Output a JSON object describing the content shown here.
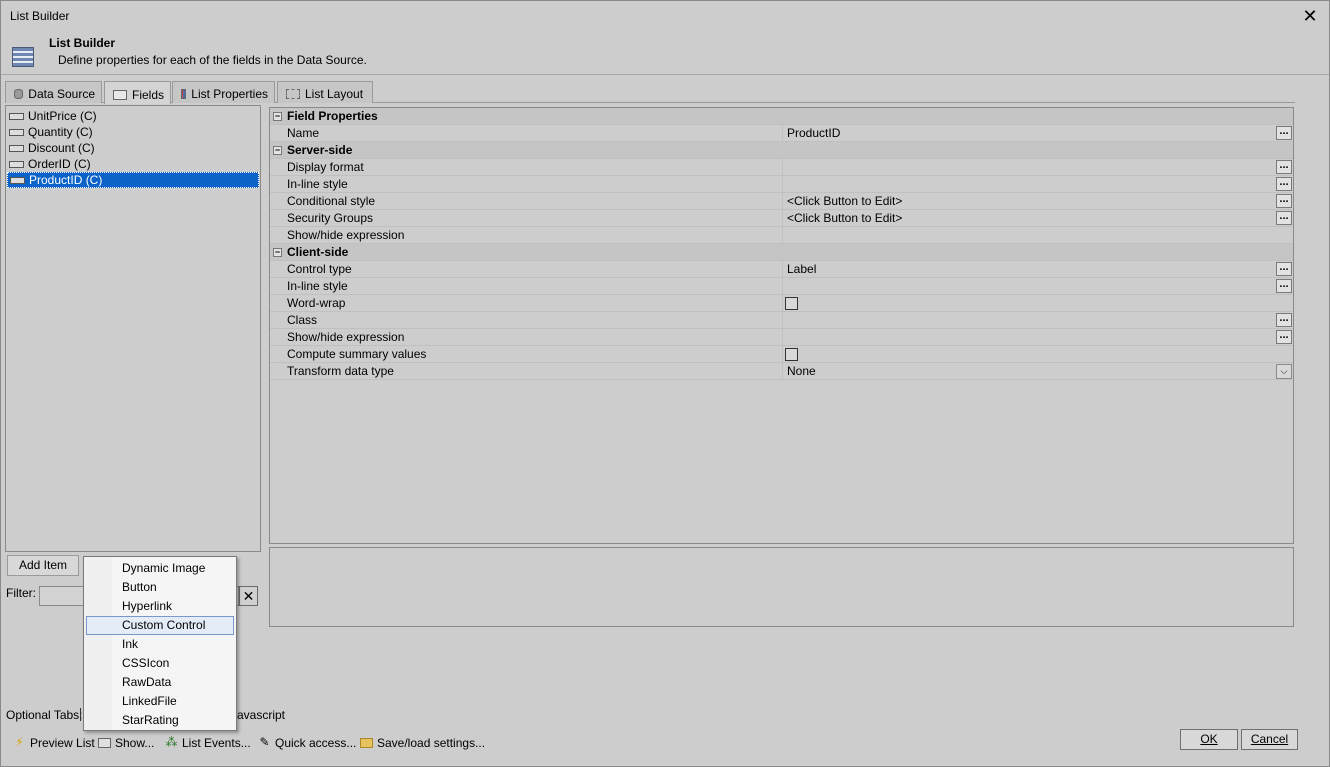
{
  "window": {
    "title": "List Builder",
    "close_glyph": "✕"
  },
  "header": {
    "title": "List Builder",
    "description": "Define properties for each of the fields in the Data Source.",
    "icon": "list-builder-icon"
  },
  "tabs": [
    {
      "label": "Data Source",
      "icon": "database-icon"
    },
    {
      "label": "Fields",
      "icon": "field-icon"
    },
    {
      "label": "List Properties",
      "icon": "list-properties-icon"
    },
    {
      "label": "List Layout",
      "icon": "list-layout-icon"
    }
  ],
  "active_tab": "Fields",
  "fields": [
    {
      "label": "UnitPrice (C)"
    },
    {
      "label": "Quantity (C)"
    },
    {
      "label": "Discount (C)"
    },
    {
      "label": "OrderID (C)"
    },
    {
      "label": "ProductID (C)"
    }
  ],
  "selected_field": "ProductID (C)",
  "add_item_label": "Add Item",
  "filter": {
    "label": "Filter:",
    "value": "",
    "clear_glyph": "✕"
  },
  "properties": {
    "field_properties": {
      "title": "Field Properties",
      "name_label": "Name",
      "name_value": "ProductID"
    },
    "server_side": {
      "title": "Server-side",
      "display_format": "Display format",
      "inline_style": "In-line style",
      "conditional_style": "Conditional style",
      "conditional_style_value": "<Click Button to Edit>",
      "security_groups": "Security Groups",
      "security_groups_value": "<Click Button to Edit>",
      "show_hide_expression": "Show/hide expression"
    },
    "client_side": {
      "title": "Client-side",
      "control_type": "Control type",
      "control_type_value": "Label",
      "inline_style": "In-line style",
      "word_wrap": "Word-wrap",
      "class": "Class",
      "show_hide_expression": "Show/hide expression",
      "compute_summary": "Compute summary values",
      "transform_data_type": "Transform data type",
      "transform_data_type_value": "None"
    },
    "ellipsis": "...",
    "collapse_glyph": "−",
    "dropdown_glyph": "⌵"
  },
  "context_menu": {
    "items": [
      "Dynamic Image",
      "Button",
      "Hyperlink",
      "Custom Control",
      "Ink",
      "CSSIcon",
      "RawData",
      "LinkedFile",
      "StarRating"
    ],
    "highlighted": "Custom Control"
  },
  "optional_tabs": {
    "label": "Optional Tabs:",
    "javascript_label": "avascript"
  },
  "toolbar": {
    "preview_list": "Preview List",
    "show": "Show...",
    "list_events": "List Events...",
    "quick_access": "Quick access...",
    "save_load_settings": "Save/load settings..."
  },
  "ok_label": "OK",
  "cancel_label": "Cancel"
}
